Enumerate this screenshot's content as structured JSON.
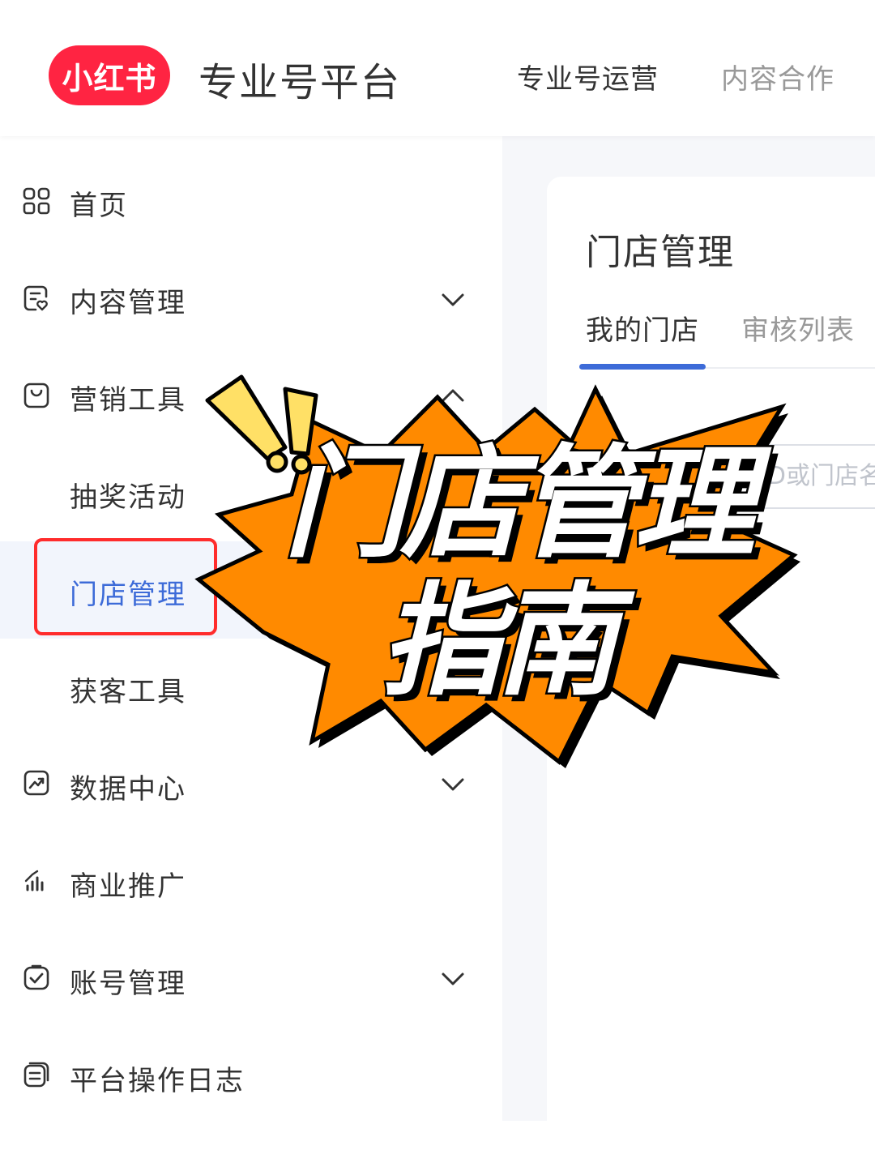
{
  "header": {
    "logo_text": "小红书",
    "app_title": "专业号平台",
    "nav": [
      "专业号运营",
      "内容合作"
    ]
  },
  "sidebar": {
    "items": [
      {
        "label": "首页",
        "icon": "grid-icon"
      },
      {
        "label": "内容管理",
        "icon": "content-doc-icon",
        "chevron": "down"
      },
      {
        "label": "营销工具",
        "icon": "bag-icon",
        "chevron": "up",
        "children": [
          {
            "label": "抽奖活动"
          },
          {
            "label": "门店管理",
            "active": true
          },
          {
            "label": "获客工具"
          }
        ]
      },
      {
        "label": "数据中心",
        "icon": "chart-icon",
        "chevron": "down"
      },
      {
        "label": "商业推广",
        "icon": "signal-icon"
      },
      {
        "label": "账号管理",
        "icon": "account-check-icon",
        "chevron": "down"
      },
      {
        "label": "平台操作日志",
        "icon": "log-icon"
      }
    ]
  },
  "main": {
    "title": "门店管理",
    "tabs": [
      {
        "label": "我的门店",
        "active": true
      },
      {
        "label": "审核列表",
        "active": false
      }
    ],
    "search_placeholder": "店ID或门店名"
  },
  "overlay": {
    "headline_line1": "门店管理",
    "headline_line2": "指南"
  },
  "colors": {
    "brand": "#ff2442",
    "accent": "#3d6bd8",
    "burst": "#ff8a00",
    "highlight": "#ff2c2c",
    "exclaim": "#ffe066"
  }
}
